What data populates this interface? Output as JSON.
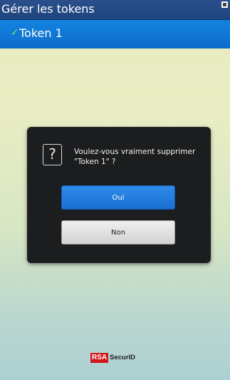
{
  "header": {
    "title": "Gérer les tokens"
  },
  "token_list": {
    "items": [
      {
        "label": "Token 1",
        "selected": true
      }
    ]
  },
  "dialog": {
    "icon": "question-icon",
    "message": "Voulez-vous vraiment supprimer \"Token 1\" ?",
    "confirm_label": "Oui",
    "cancel_label": "Non"
  },
  "footer": {
    "logo_brand": "RSA",
    "logo_product": "SecurID"
  },
  "colors": {
    "header_bg": "#1f457f",
    "selected_row_bg": "#0d6ccb",
    "checkmark": "#6fe070",
    "dialog_bg": "#1b1d1f",
    "confirm_button": "#1a6fd3",
    "cancel_button": "#d2d2d2",
    "rsa_red": "#d4171c"
  }
}
